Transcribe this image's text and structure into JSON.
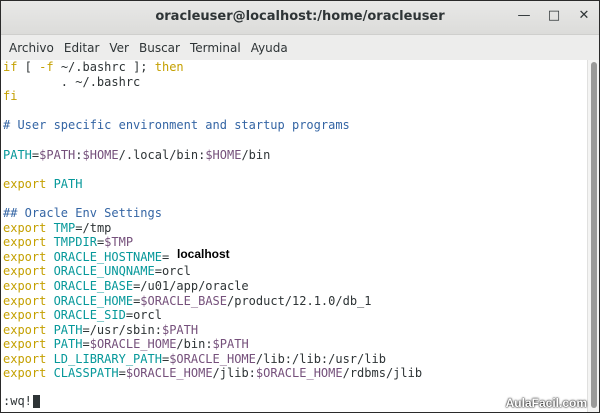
{
  "window": {
    "title": "oracleuser@localhost:/home/oracleuser"
  },
  "controls": {
    "minimize": "—",
    "maximize": "□",
    "close": "✕"
  },
  "menu": [
    "Archivo",
    "Editar",
    "Ver",
    "Buscar",
    "Terminal",
    "Ayuda"
  ],
  "terminal": {
    "lines": [
      [
        {
          "t": "if",
          "c": "kw"
        },
        {
          "t": " [ ",
          "c": "norm"
        },
        {
          "t": "-f",
          "c": "kw"
        },
        {
          "t": " ~/.bashrc ]; ",
          "c": "norm"
        },
        {
          "t": "then",
          "c": "kw"
        }
      ],
      [
        {
          "t": "        . ~/.bashrc",
          "c": "norm"
        }
      ],
      [
        {
          "t": "fi",
          "c": "kw"
        }
      ],
      [
        {
          "t": "",
          "c": "norm"
        }
      ],
      [
        {
          "t": "# User specific environment and startup programs",
          "c": "com"
        }
      ],
      [
        {
          "t": "",
          "c": "norm"
        }
      ],
      [
        {
          "t": "PATH",
          "c": "name"
        },
        {
          "t": "=",
          "c": "norm"
        },
        {
          "t": "$PATH",
          "c": "mag"
        },
        {
          "t": ":",
          "c": "norm"
        },
        {
          "t": "$HOME",
          "c": "mag"
        },
        {
          "t": "/.local/bin:",
          "c": "norm"
        },
        {
          "t": "$HOME",
          "c": "mag"
        },
        {
          "t": "/bin",
          "c": "norm"
        }
      ],
      [
        {
          "t": "",
          "c": "norm"
        }
      ],
      [
        {
          "t": "export",
          "c": "exp"
        },
        {
          "t": " PATH",
          "c": "name"
        }
      ],
      [
        {
          "t": "",
          "c": "norm"
        }
      ],
      [
        {
          "t": "## Oracle Env Settings",
          "c": "com"
        }
      ],
      [
        {
          "t": "export",
          "c": "exp"
        },
        {
          "t": " TMP",
          "c": "name"
        },
        {
          "t": "=/tmp",
          "c": "norm"
        }
      ],
      [
        {
          "t": "export",
          "c": "exp"
        },
        {
          "t": " TMPDIR",
          "c": "name"
        },
        {
          "t": "=",
          "c": "norm"
        },
        {
          "t": "$TMP",
          "c": "mag"
        }
      ],
      [
        {
          "t": "export",
          "c": "exp"
        },
        {
          "t": " ORACLE_HOSTNAME",
          "c": "name"
        },
        {
          "t": "=",
          "c": "norm"
        }
      ],
      [
        {
          "t": "export",
          "c": "exp"
        },
        {
          "t": " ORACLE_UNQNAME",
          "c": "name"
        },
        {
          "t": "=orcl",
          "c": "norm"
        }
      ],
      [
        {
          "t": "export",
          "c": "exp"
        },
        {
          "t": " ORACLE_BASE",
          "c": "name"
        },
        {
          "t": "=/u01/app/oracle",
          "c": "norm"
        }
      ],
      [
        {
          "t": "export",
          "c": "exp"
        },
        {
          "t": " ORACLE_HOME",
          "c": "name"
        },
        {
          "t": "=",
          "c": "norm"
        },
        {
          "t": "$ORACLE_BASE",
          "c": "mag"
        },
        {
          "t": "/product/12.1.0/db_1",
          "c": "norm"
        }
      ],
      [
        {
          "t": "export",
          "c": "exp"
        },
        {
          "t": " ORACLE_SID",
          "c": "name"
        },
        {
          "t": "=orcl",
          "c": "norm"
        }
      ],
      [
        {
          "t": "export",
          "c": "exp"
        },
        {
          "t": " PATH",
          "c": "name"
        },
        {
          "t": "=/usr/sbin:",
          "c": "norm"
        },
        {
          "t": "$PATH",
          "c": "mag"
        }
      ],
      [
        {
          "t": "export",
          "c": "exp"
        },
        {
          "t": " PATH",
          "c": "name"
        },
        {
          "t": "=",
          "c": "norm"
        },
        {
          "t": "$ORACLE_HOME",
          "c": "mag"
        },
        {
          "t": "/bin:",
          "c": "norm"
        },
        {
          "t": "$PATH",
          "c": "mag"
        }
      ],
      [
        {
          "t": "export",
          "c": "exp"
        },
        {
          "t": " LD_LIBRARY_PATH",
          "c": "name"
        },
        {
          "t": "=",
          "c": "norm"
        },
        {
          "t": "$ORACLE_HOME",
          "c": "mag"
        },
        {
          "t": "/lib:/lib:/usr/lib",
          "c": "norm"
        }
      ],
      [
        {
          "t": "export",
          "c": "exp"
        },
        {
          "t": " CLASSPATH",
          "c": "name"
        },
        {
          "t": "=",
          "c": "norm"
        },
        {
          "t": "$ORACLE_HOME",
          "c": "mag"
        },
        {
          "t": "/jlib:",
          "c": "norm"
        },
        {
          "t": "$ORACLE_HOME",
          "c": "mag"
        },
        {
          "t": "/rdbms/jlib",
          "c": "norm"
        }
      ]
    ],
    "command": ":wq!"
  },
  "tooltip": "localhost",
  "watermark": "AulaFacil.com",
  "colors": {
    "keyword": "#c4a000",
    "comment": "#3465a4",
    "variable": "#75507b",
    "name": "#06989a",
    "text": "#2e3436"
  }
}
